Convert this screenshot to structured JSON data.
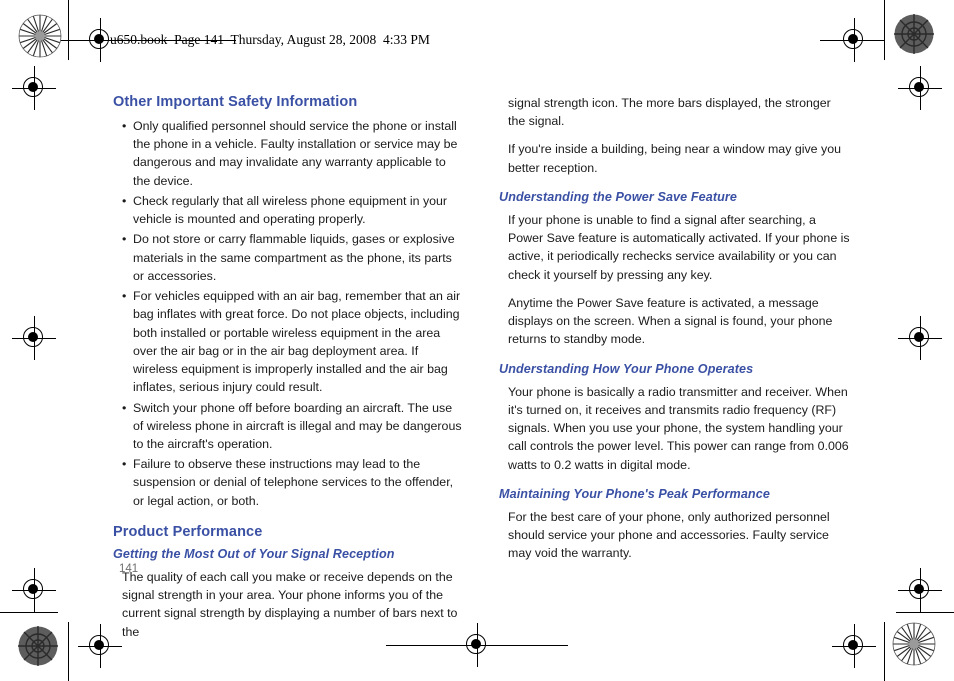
{
  "document": {
    "running_header": "u650.book  Page 141  Thursday, August 28, 2008  4:33 PM",
    "page_number": "141",
    "heading_color": "#3a50a4",
    "body_color": "#1b1b1b",
    "page_number_color": "#6f6f6f"
  },
  "left_column": {
    "section_heading": "Other Important Safety Information",
    "bullets": [
      "Only qualified personnel should service the phone or install the phone in a vehicle. Faulty installation or service may be dangerous and may invalidate any warranty applicable to the device.",
      "Check regularly that all wireless phone equipment in your vehicle is mounted and operating properly.",
      "Do not store or carry flammable liquids, gases or explosive materials in the same compartment as the phone, its parts or accessories.",
      "For vehicles equipped with an air bag, remember that an air bag inflates with great force. Do not place objects, including both installed or portable wireless equipment in the area over the air bag or in the air bag deployment area. If wireless equipment is improperly installed and the air bag inflates, serious injury could result.",
      "Switch your phone off before boarding an aircraft. The use of wireless phone in aircraft is illegal and may be dangerous to the aircraft's operation.",
      "Failure to observe these instructions may lead to the suspension or denial of telephone services to the offender, or legal action, or both."
    ],
    "section_heading_2": "Product Performance",
    "subheading_1": "Getting the Most Out of Your Signal Reception",
    "paragraph_1": "The quality of each call you make or receive depends on the signal strength in your area. Your phone informs you of the current signal strength by displaying a number of bars next to the"
  },
  "right_column": {
    "paragraph_continued": "signal strength icon. The more bars displayed, the stronger the signal.",
    "paragraph_2": "If you're inside a building, being near a window may give you better reception.",
    "subheading_2": "Understanding the Power Save Feature",
    "paragraph_3": "If your phone is unable to find a signal after searching, a Power Save feature is automatically activated. If your phone is active, it periodically rechecks service availability or you can check it yourself by pressing any key.",
    "paragraph_4": "Anytime the Power Save feature is activated, a message displays on the screen. When a signal is found, your phone returns to standby mode.",
    "subheading_3": "Understanding How Your Phone Operates",
    "paragraph_5": "Your phone is basically a radio transmitter and receiver. When it's turned on, it receives and transmits radio frequency (RF) signals. When you use your phone, the system handling your call controls the power level. This power can range from 0.006 watts to 0.2 watts in digital mode.",
    "subheading_4": "Maintaining Your Phone's Peak Performance",
    "paragraph_6": "For the best care of your phone, only authorized personnel should service your phone and accessories. Faulty service may void the warranty."
  }
}
